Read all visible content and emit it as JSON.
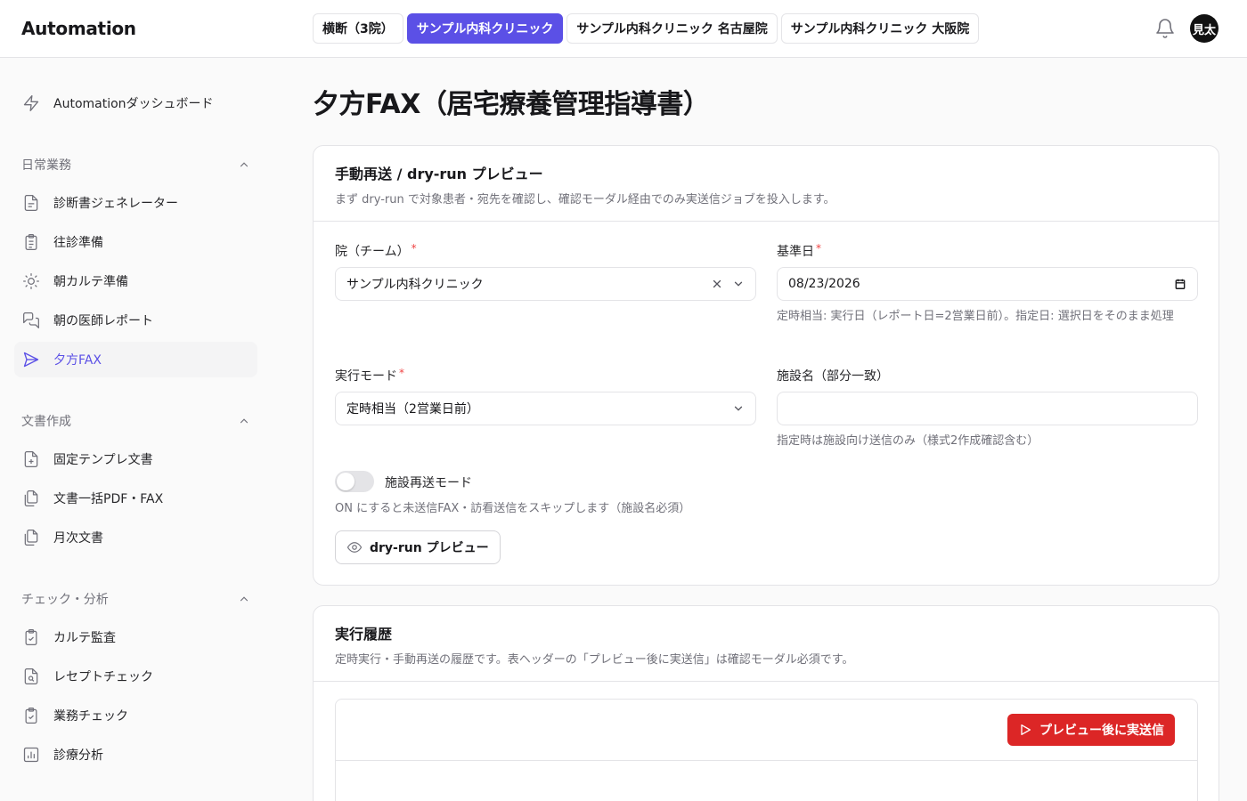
{
  "header": {
    "brand": "Automation",
    "tabs": [
      {
        "label": "横断（3院）",
        "active": false
      },
      {
        "label": "サンプル内科クリニック",
        "active": true
      },
      {
        "label": "サンプル内科クリニック 名古屋院",
        "active": false
      },
      {
        "label": "サンプル内科クリニック 大阪院",
        "active": false
      }
    ],
    "avatar_text": "見太"
  },
  "sidebar": {
    "top_item": {
      "label": "Automationダッシュボード",
      "icon": "lightning-icon"
    },
    "groups": [
      {
        "label": "日常業務",
        "items": [
          {
            "label": "診断書ジェネレーター",
            "icon": "document-icon"
          },
          {
            "label": "往診準備",
            "icon": "clipboard-icon"
          },
          {
            "label": "朝カルテ準備",
            "icon": "sun-icon"
          },
          {
            "label": "朝の医師レポート",
            "icon": "chat-icon"
          },
          {
            "label": "夕方FAX",
            "icon": "send-icon",
            "active": true
          }
        ]
      },
      {
        "label": "文書作成",
        "items": [
          {
            "label": "固定テンプレ文書",
            "icon": "file-plus-icon"
          },
          {
            "label": "文書一括PDF・FAX",
            "icon": "files-icon"
          },
          {
            "label": "月次文書",
            "icon": "files-icon"
          }
        ]
      },
      {
        "label": "チェック・分析",
        "items": [
          {
            "label": "カルテ監査",
            "icon": "clipboard-check-icon"
          },
          {
            "label": "レセプトチェック",
            "icon": "file-search-icon"
          },
          {
            "label": "業務チェック",
            "icon": "clipboard-check-icon"
          },
          {
            "label": "診療分析",
            "icon": "bar-chart-icon"
          }
        ]
      }
    ]
  },
  "main": {
    "title": "夕方FAX（居宅療養管理指導書）",
    "form_card": {
      "title": "手動再送 / dry-run プレビュー",
      "description": "まず dry-run で対象患者・宛先を確認し、確認モーダル経由でのみ実送信ジョブを投入します。",
      "clinic_label": "院（チーム）",
      "clinic_value": "サンプル内科クリニック",
      "date_label": "基準日",
      "date_value": "08/23/2026",
      "date_hint": "定時相当: 実行日（レポート日=2営業日前）。指定日: 選択日をそのまま処理",
      "mode_label": "実行モード",
      "mode_value": "定時相当（2営業日前）",
      "facility_label": "施設名（部分一致）",
      "facility_value": "",
      "facility_hint": "指定時は施設向け送信のみ（様式2作成確認含む）",
      "toggle_label": "施設再送モード",
      "toggle_on": false,
      "toggle_hint": "ON にすると未送信FAX・訪看送信をスキップします（施設名必須）",
      "preview_button": "dry-run プレビュー"
    },
    "history_card": {
      "title": "実行履歴",
      "description": "定時実行・手動再送の履歴です。表ヘッダーの「プレビュー後に実送信」は確認モーダル必須です。",
      "send_button": "プレビュー後に実送信"
    }
  },
  "colors": {
    "accent": "#5b50e6",
    "danger": "#dc2626",
    "required": "#ef4444"
  }
}
